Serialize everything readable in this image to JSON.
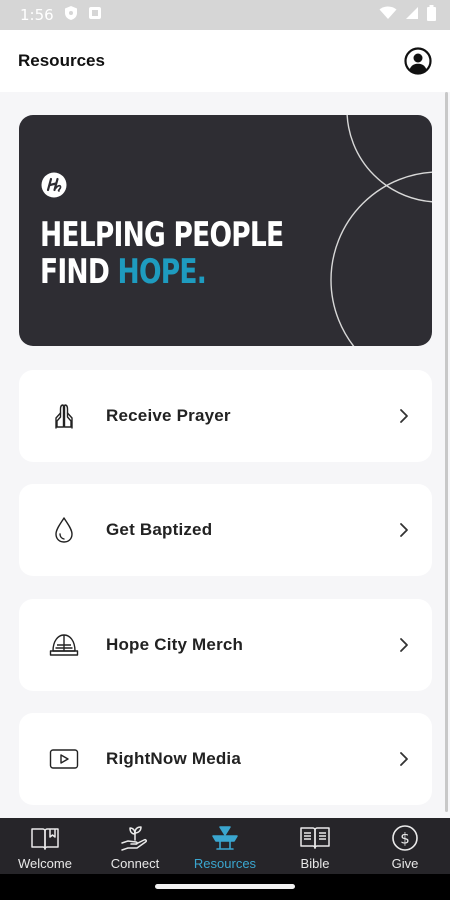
{
  "status_bar": {
    "time": "1:56",
    "icons": [
      "shield-icon",
      "notification-icon",
      "wifi-icon",
      "signal-icon",
      "battery-icon"
    ]
  },
  "header": {
    "title": "Resources",
    "profile_icon": "profile-icon"
  },
  "hero": {
    "line1": "HELPING PEOPLE",
    "line2_prefix": "FIND ",
    "line2_accent": "HOPE.",
    "accent_color": "#1e9bbf",
    "background_color": "#2e2d33"
  },
  "items": [
    {
      "label": "Receive Prayer",
      "icon": "praying-hands-icon"
    },
    {
      "label": "Get Baptized",
      "icon": "water-drop-icon"
    },
    {
      "label": "Hope City Merch",
      "icon": "cap-icon"
    },
    {
      "label": "RightNow Media",
      "icon": "play-video-icon"
    }
  ],
  "bottom_nav": {
    "active_color": "#3aa6cf",
    "items": [
      {
        "label": "Welcome",
        "icon": "book-icon",
        "active": false
      },
      {
        "label": "Connect",
        "icon": "hand-plant-icon",
        "active": false
      },
      {
        "label": "Resources",
        "icon": "podium-icon",
        "active": true
      },
      {
        "label": "Bible",
        "icon": "open-bible-icon",
        "active": false
      },
      {
        "label": "Give",
        "icon": "dollar-icon",
        "active": false
      }
    ]
  }
}
